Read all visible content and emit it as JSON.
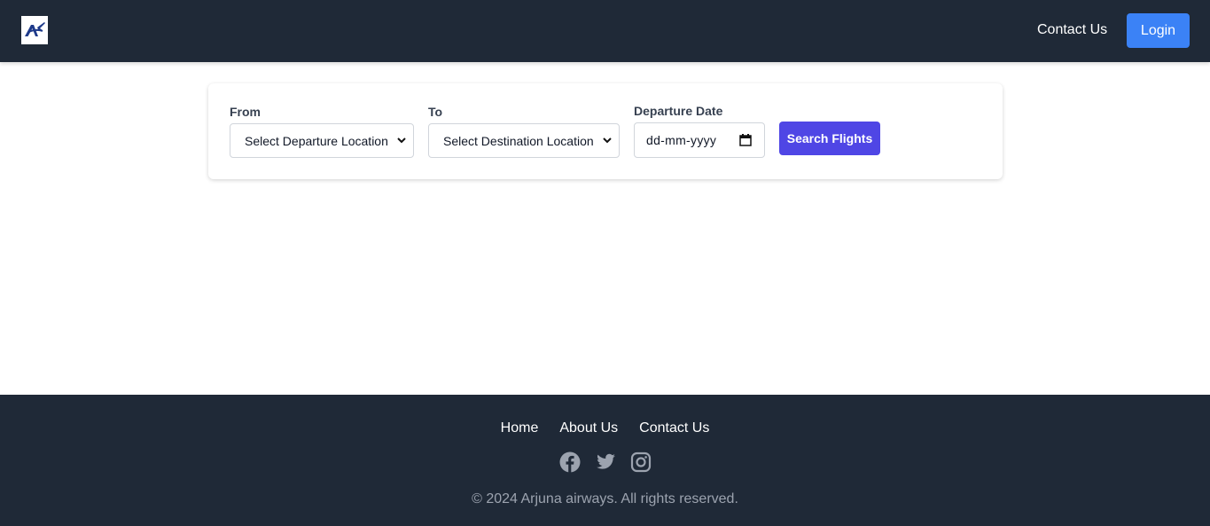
{
  "header": {
    "logo_icon": "airline-logo-icon",
    "contact_label": "Contact Us",
    "login_label": "Login",
    "bg_color": "#1f2937",
    "login_color": "#3b82f6"
  },
  "search": {
    "from_label": "From",
    "from_value": "Select Departure Location",
    "to_label": "To",
    "to_value": "Select Destination Location",
    "date_label": "Departure Date",
    "date_placeholder": "dd-mm-yyyy",
    "search_label": "Search Flights",
    "search_color": "#4f46e5"
  },
  "footer": {
    "links": [
      "Home",
      "About Us",
      "Contact Us"
    ],
    "social_icons": [
      "facebook-icon",
      "twitter-icon",
      "instagram-icon"
    ],
    "copyright": "© 2024 Arjuna airways. All rights reserved."
  }
}
